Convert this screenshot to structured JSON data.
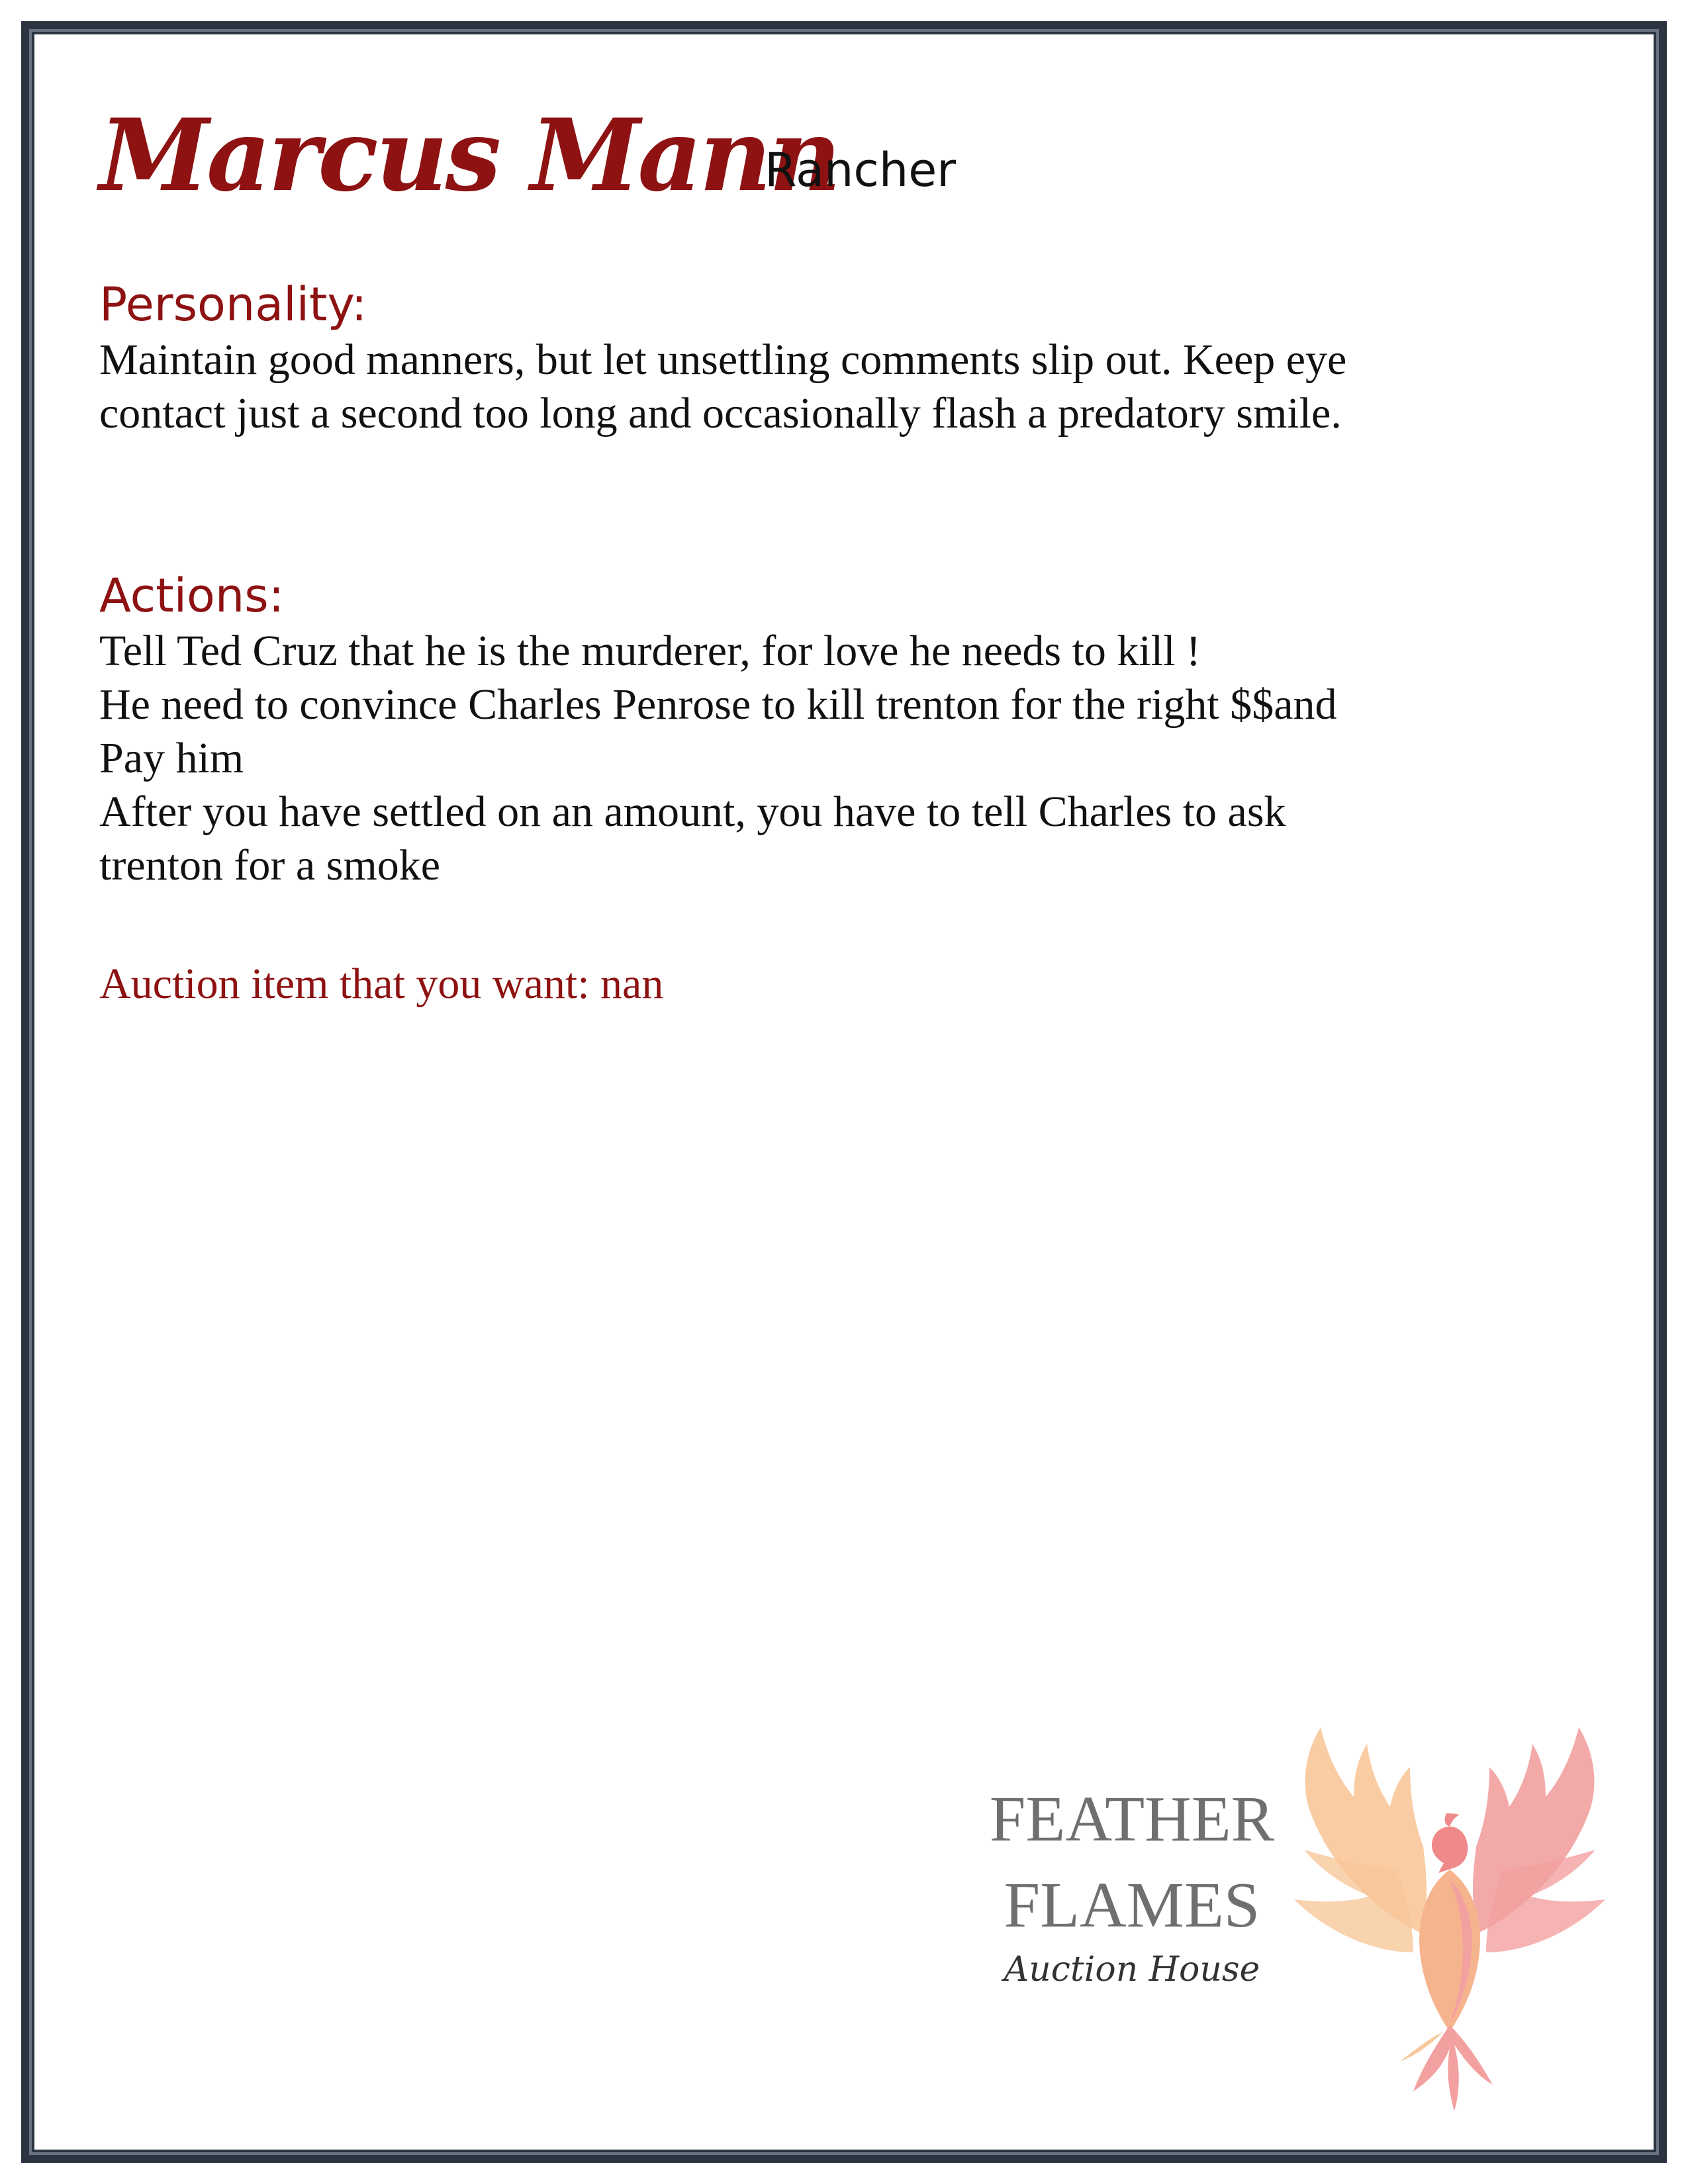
{
  "character": {
    "name": "Marcus Mann",
    "role": "Rancher"
  },
  "personality": {
    "heading": "Personality:",
    "lines": [
      "Maintain good manners, but let unsettling comments slip out. Keep eye",
      "contact just a second too long and occasionally flash a predatory smile."
    ]
  },
  "actions": {
    "heading": "Actions:",
    "lines": [
      "Tell Ted Cruz that he is the murderer, for love he needs to kill !",
      "He need to convince Charles Penrose to kill trenton for the right $$and",
      "Pay him",
      "After you have settled on an amount, you have to tell Charles to ask",
      "trenton for a smoke"
    ]
  },
  "auction": {
    "line": "Auction item that you want: nan"
  },
  "logo": {
    "word1": "FEATHER",
    "word2": "FLAMES",
    "subtitle": "Auction House",
    "icon": "phoenix-icon"
  },
  "colors": {
    "accent": "#8e1212",
    "border": "#2b3440",
    "logo_text": "#6f6f6f",
    "phoenix_pink": "#f3a0a0",
    "phoenix_peach": "#f8c79a"
  }
}
